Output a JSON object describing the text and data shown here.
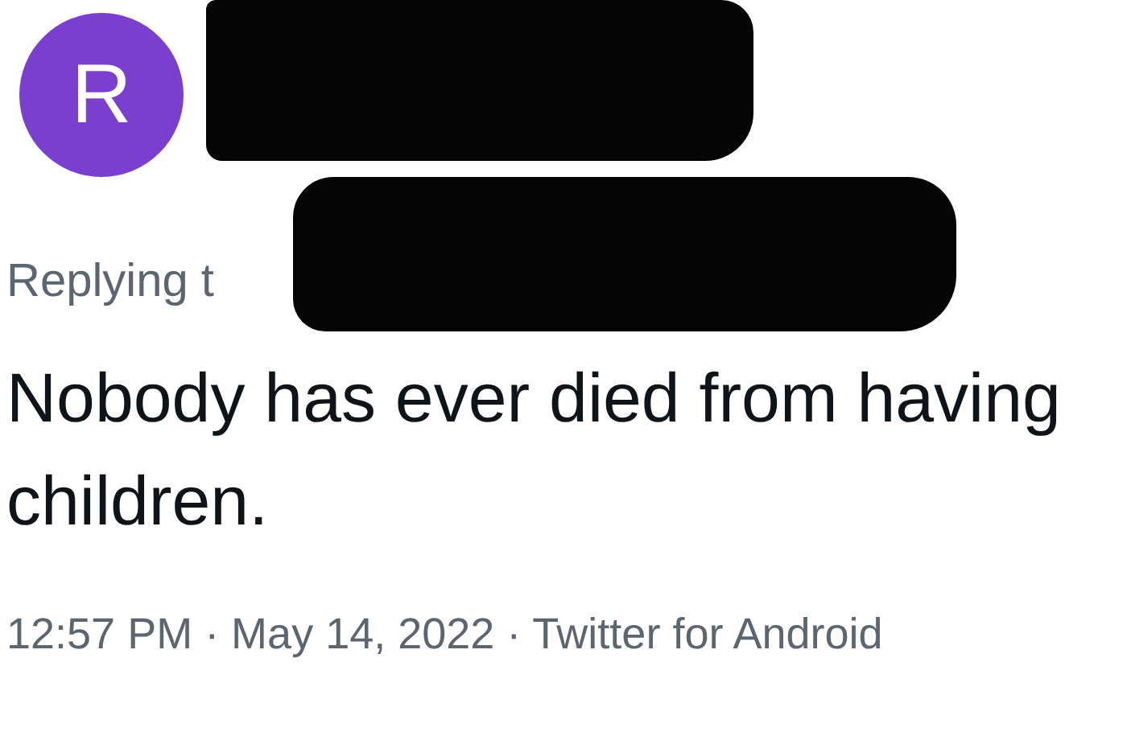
{
  "avatar": {
    "letter": "R"
  },
  "reply_context": "Replying t",
  "text": "Nobody has ever died from having children.",
  "meta": "12:57 PM · May 14, 2022 · Twitter for Android"
}
